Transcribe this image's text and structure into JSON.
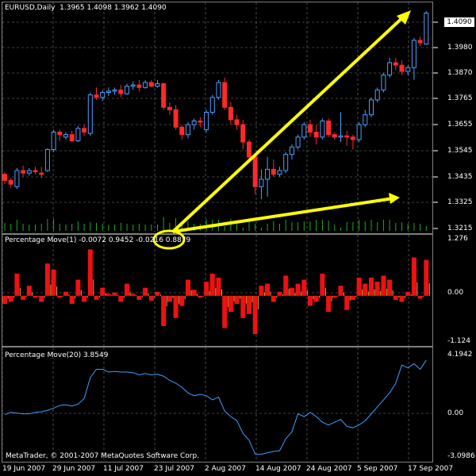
{
  "window": {
    "title": "EURUSD,Daily",
    "ohlc": "1.3965 1.4098 1.3962 1.4090",
    "last_price_tag": "1.4090"
  },
  "panes": {
    "price": {
      "y_labels": [
        "1.3980",
        "1.3870",
        "1.3765",
        "1.3655",
        "1.3545",
        "1.3435",
        "1.3325",
        "1.3215"
      ]
    },
    "pm1": {
      "title": "Percentage Move(1) -0.0072 0.9452 -0.0216 0.8879",
      "y_labels": [
        "1.276",
        "0.00",
        "-1.124"
      ]
    },
    "pm20": {
      "title": "Percentage Move(20) 3.8549",
      "y_labels": [
        "4.1942",
        "0.00",
        "-3.0986"
      ]
    }
  },
  "x_labels": [
    "19 Jun 2007",
    "29 Jun 2007",
    "11 Jul 2007",
    "23 Jul 2007",
    "2 Aug 2007",
    "14 Aug 2007",
    "24 Aug 2007",
    "5 Sep 2007",
    "17 Sep 2007"
  ],
  "footer": {
    "copyright": "MetaTrader, © 2001-2007 MetaQuotes Software Corp."
  },
  "colors": {
    "up_candle": "#4aa0ff",
    "down_candle": "#ff2a2a",
    "grid": "#7f7f7f",
    "volume": "#22aa22",
    "annotation": "#ffff00",
    "line": "#3aa0ff"
  },
  "chart_data": [
    {
      "type": "candlestick",
      "title": "EURUSD,Daily",
      "ylim": [
        1.3215,
        1.4098
      ],
      "candles": [
        {
          "o": 1.344,
          "h": 1.345,
          "l": 1.34,
          "c": 1.3415
        },
        {
          "o": 1.3415,
          "h": 1.3425,
          "l": 1.3385,
          "c": 1.34
        },
        {
          "o": 1.339,
          "h": 1.3465,
          "l": 1.338,
          "c": 1.3455
        },
        {
          "o": 1.3455,
          "h": 1.3475,
          "l": 1.343,
          "c": 1.3445
        },
        {
          "o": 1.3445,
          "h": 1.3465,
          "l": 1.3435,
          "c": 1.3455
        },
        {
          "o": 1.3455,
          "h": 1.347,
          "l": 1.344,
          "c": 1.345
        },
        {
          "o": 1.3445,
          "h": 1.347,
          "l": 1.3425,
          "c": 1.344
        },
        {
          "o": 1.3455,
          "h": 1.3545,
          "l": 1.345,
          "c": 1.354
        },
        {
          "o": 1.354,
          "h": 1.362,
          "l": 1.353,
          "c": 1.361
        },
        {
          "o": 1.361,
          "h": 1.362,
          "l": 1.3575,
          "c": 1.36
        },
        {
          "o": 1.359,
          "h": 1.361,
          "l": 1.358,
          "c": 1.36
        },
        {
          "o": 1.36,
          "h": 1.3615,
          "l": 1.357,
          "c": 1.3575
        },
        {
          "o": 1.3575,
          "h": 1.3635,
          "l": 1.357,
          "c": 1.3625
        },
        {
          "o": 1.3625,
          "h": 1.364,
          "l": 1.3595,
          "c": 1.361
        },
        {
          "o": 1.3605,
          "h": 1.377,
          "l": 1.3595,
          "c": 1.376
        },
        {
          "o": 1.376,
          "h": 1.379,
          "l": 1.374,
          "c": 1.375
        },
        {
          "o": 1.375,
          "h": 1.378,
          "l": 1.3735,
          "c": 1.377
        },
        {
          "o": 1.377,
          "h": 1.379,
          "l": 1.3755,
          "c": 1.3775
        },
        {
          "o": 1.3775,
          "h": 1.379,
          "l": 1.376,
          "c": 1.378
        },
        {
          "o": 1.378,
          "h": 1.38,
          "l": 1.375,
          "c": 1.3765
        },
        {
          "o": 1.3765,
          "h": 1.3805,
          "l": 1.376,
          "c": 1.3795
        },
        {
          "o": 1.3795,
          "h": 1.3815,
          "l": 1.378,
          "c": 1.38
        },
        {
          "o": 1.38,
          "h": 1.382,
          "l": 1.3775,
          "c": 1.379
        },
        {
          "o": 1.379,
          "h": 1.382,
          "l": 1.3785,
          "c": 1.381
        },
        {
          "o": 1.381,
          "h": 1.382,
          "l": 1.379,
          "c": 1.3795
        },
        {
          "o": 1.3795,
          "h": 1.382,
          "l": 1.379,
          "c": 1.3805
        },
        {
          "o": 1.3805,
          "h": 1.381,
          "l": 1.37,
          "c": 1.371
        },
        {
          "o": 1.371,
          "h": 1.373,
          "l": 1.368,
          "c": 1.37
        },
        {
          "o": 1.37,
          "h": 1.372,
          "l": 1.362,
          "c": 1.363
        },
        {
          "o": 1.363,
          "h": 1.364,
          "l": 1.358,
          "c": 1.36
        },
        {
          "o": 1.36,
          "h": 1.365,
          "l": 1.3585,
          "c": 1.364
        },
        {
          "o": 1.364,
          "h": 1.3665,
          "l": 1.362,
          "c": 1.3655
        },
        {
          "o": 1.3655,
          "h": 1.367,
          "l": 1.363,
          "c": 1.365
        },
        {
          "o": 1.362,
          "h": 1.37,
          "l": 1.361,
          "c": 1.369
        },
        {
          "o": 1.369,
          "h": 1.376,
          "l": 1.368,
          "c": 1.375
        },
        {
          "o": 1.375,
          "h": 1.382,
          "l": 1.374,
          "c": 1.381
        },
        {
          "o": 1.381,
          "h": 1.383,
          "l": 1.37,
          "c": 1.371
        },
        {
          "o": 1.371,
          "h": 1.373,
          "l": 1.364,
          "c": 1.366
        },
        {
          "o": 1.366,
          "h": 1.368,
          "l": 1.362,
          "c": 1.364
        },
        {
          "o": 1.364,
          "h": 1.366,
          "l": 1.354,
          "c": 1.357
        },
        {
          "o": 1.357,
          "h": 1.358,
          "l": 1.349,
          "c": 1.351
        },
        {
          "o": 1.351,
          "h": 1.352,
          "l": 1.336,
          "c": 1.339
        },
        {
          "o": 1.339,
          "h": 1.346,
          "l": 1.334,
          "c": 1.342
        },
        {
          "o": 1.342,
          "h": 1.351,
          "l": 1.335,
          "c": 1.346
        },
        {
          "o": 1.346,
          "h": 1.35,
          "l": 1.343,
          "c": 1.344
        },
        {
          "o": 1.344,
          "h": 1.347,
          "l": 1.343,
          "c": 1.3455
        },
        {
          "o": 1.3455,
          "h": 1.353,
          "l": 1.3445,
          "c": 1.352
        },
        {
          "o": 1.352,
          "h": 1.356,
          "l": 1.35,
          "c": 1.355
        },
        {
          "o": 1.355,
          "h": 1.36,
          "l": 1.354,
          "c": 1.359
        },
        {
          "o": 1.359,
          "h": 1.365,
          "l": 1.358,
          "c": 1.364
        },
        {
          "o": 1.364,
          "h": 1.366,
          "l": 1.359,
          "c": 1.361
        },
        {
          "o": 1.361,
          "h": 1.364,
          "l": 1.356,
          "c": 1.359
        },
        {
          "o": 1.359,
          "h": 1.3665,
          "l": 1.358,
          "c": 1.3655
        },
        {
          "o": 1.3655,
          "h": 1.3665,
          "l": 1.359,
          "c": 1.36
        },
        {
          "o": 1.36,
          "h": 1.361,
          "l": 1.358,
          "c": 1.359
        },
        {
          "o": 1.359,
          "h": 1.369,
          "l": 1.357,
          "c": 1.3595
        },
        {
          "o": 1.3595,
          "h": 1.3615,
          "l": 1.3555,
          "c": 1.359
        },
        {
          "o": 1.359,
          "h": 1.36,
          "l": 1.354,
          "c": 1.358
        },
        {
          "o": 1.358,
          "h": 1.365,
          "l": 1.357,
          "c": 1.364
        },
        {
          "o": 1.364,
          "h": 1.37,
          "l": 1.363,
          "c": 1.368
        },
        {
          "o": 1.368,
          "h": 1.375,
          "l": 1.367,
          "c": 1.374
        },
        {
          "o": 1.374,
          "h": 1.379,
          "l": 1.373,
          "c": 1.378
        },
        {
          "o": 1.378,
          "h": 1.385,
          "l": 1.377,
          "c": 1.384
        },
        {
          "o": 1.384,
          "h": 1.391,
          "l": 1.383,
          "c": 1.389
        },
        {
          "o": 1.389,
          "h": 1.391,
          "l": 1.386,
          "c": 1.388
        },
        {
          "o": 1.388,
          "h": 1.39,
          "l": 1.384,
          "c": 1.3855
        },
        {
          "o": 1.3855,
          "h": 1.388,
          "l": 1.384,
          "c": 1.387
        },
        {
          "o": 1.387,
          "h": 1.399,
          "l": 1.382,
          "c": 1.398
        },
        {
          "o": 1.398,
          "h": 1.3995,
          "l": 1.3955,
          "c": 1.397
        },
        {
          "o": 1.3965,
          "h": 1.4098,
          "l": 1.3962,
          "c": 1.409
        }
      ]
    },
    {
      "type": "bar",
      "title": "Percentage Move(1) -0.0072 0.9452 -0.0216 0.8879",
      "ylim": [
        -1.124,
        1.276
      ],
      "values": [
        -0.2,
        -0.15,
        0.55,
        -0.1,
        0.25,
        -0.05,
        -0.15,
        0.8,
        0.65,
        -0.05,
        0.1,
        -0.2,
        0.4,
        -0.15,
        1.15,
        -0.1,
        0.2,
        0.05,
        0.08,
        -0.15,
        0.3,
        0.05,
        -0.1,
        0.2,
        -0.12,
        0.1,
        -0.75,
        -0.15,
        -0.55,
        -0.25,
        0.4,
        0.15,
        -0.05,
        0.35,
        0.55,
        0.45,
        -0.8,
        -0.4,
        -0.2,
        -0.55,
        -0.45,
        -0.95,
        0.25,
        0.3,
        -0.15,
        0.1,
        0.5,
        0.2,
        0.3,
        0.4,
        -0.25,
        -0.15,
        0.55,
        -0.4,
        -0.05,
        0.25,
        -0.35,
        -0.1,
        0.45,
        0.3,
        0.45,
        0.35,
        0.5,
        0.4,
        -0.1,
        -0.15,
        0.1,
        0.95,
        -0.07,
        0.89
      ]
    },
    {
      "type": "line",
      "title": "Percentage Move(20) 3.8549",
      "ylim": [
        -3.0986,
        4.1942
      ],
      "values": [
        -0.05,
        0.1,
        0.05,
        0.0,
        0.0,
        0.1,
        0.15,
        0.25,
        0.4,
        0.6,
        0.65,
        0.55,
        0.7,
        1.1,
        2.6,
        3.2,
        3.2,
        3.0,
        3.05,
        3.0,
        3.0,
        2.95,
        2.8,
        2.9,
        2.8,
        2.85,
        2.7,
        2.4,
        2.2,
        1.9,
        1.5,
        1.3,
        1.4,
        1.3,
        1.0,
        1.2,
        0.2,
        -0.2,
        -0.5,
        -1.4,
        -1.9,
        -2.9,
        -2.9,
        -2.8,
        -2.7,
        -2.65,
        -1.8,
        -1.3,
        0.0,
        -0.2,
        0.1,
        -0.2,
        -0.6,
        -0.8,
        -0.6,
        -0.4,
        -0.9,
        -1.0,
        -0.8,
        -0.5,
        0.0,
        0.5,
        1.0,
        1.5,
        2.2,
        3.5,
        3.3,
        3.6,
        3.2,
        3.85
      ]
    }
  ]
}
